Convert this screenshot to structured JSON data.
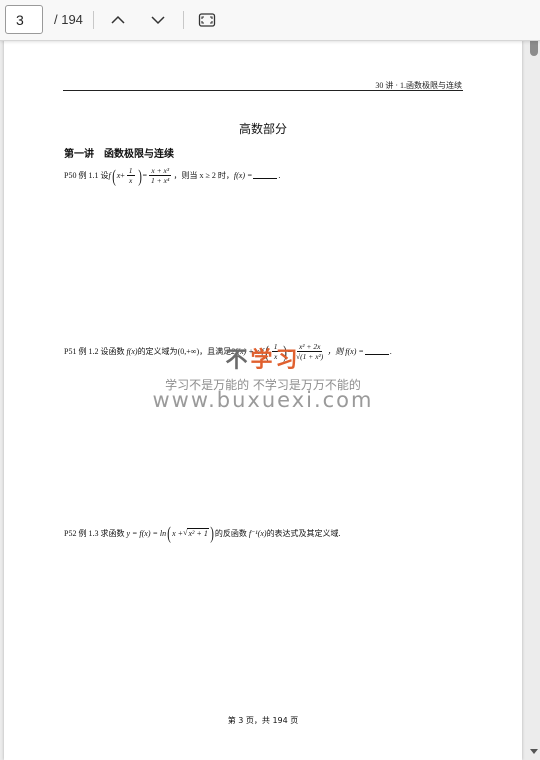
{
  "toolbar": {
    "page_number": "3",
    "page_total": "/ 194",
    "icons": {
      "prev": "chevron-up-icon",
      "next": "chevron-down-icon",
      "fit": "fit-page-icon"
    }
  },
  "page": {
    "header": "30 讲 · 1.函数极限与连续",
    "title": "高数部分",
    "lecture": "第一讲　函数极限与连续",
    "problems": [
      {
        "label": "P50 例 1.1 设",
        "func": "f",
        "inner_x": "x",
        "inner_plus": "+",
        "inner_num": "1",
        "inner_den": "x",
        "eq": "=",
        "rhs_num": "x + x³",
        "rhs_den": "1 + x⁴",
        "cond": "，则当 x ≥ 2 时，",
        "ask": "f(x) =",
        "end": "."
      },
      {
        "label": "P51 例 1.2 设函数",
        "fx": "f(x)",
        "domain_text": "的定义域为",
        "domain": "(0,+∞)",
        "cond": "，且满足",
        "coef": "2f(x) + x²f",
        "inner_num": "1",
        "inner_den": "x",
        "eq": "=",
        "rhs_num": "x² + 2x",
        "rhs_den": "√(1 + x²)",
        "ask": "，则 f(x) =",
        "end": "."
      },
      {
        "label": "P52 例 1.3 求函数",
        "expr": "y = f(x) = ln",
        "inner_a": "x +",
        "inner_rad": "x² + 1",
        "tail_a": "的反函数",
        "inverse": "f⁻¹(x)",
        "tail_b": "的表达式及其定义域."
      }
    ],
    "watermark": {
      "title_a": "不",
      "title_b": "学习",
      "slogan": "学习不是万能的 不学习是万万不能的",
      "url": "www.buxuexi.com"
    },
    "footer": "第 3 页，共 194 页"
  },
  "colors": {
    "watermark_accent": "#e0602f",
    "watermark_gray": "#8e8e8e"
  }
}
